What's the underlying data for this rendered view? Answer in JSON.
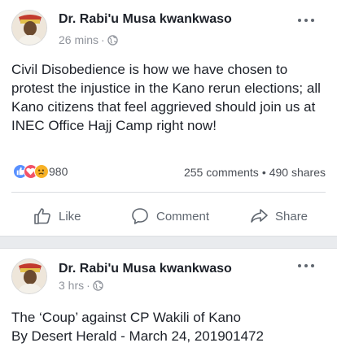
{
  "posts": [
    {
      "author": "Dr. Rabi'u Musa kwankwaso",
      "time": "26 mins",
      "text": "Civil Disobedience is how we have chosen to protest the injustice in the Kano rerun elections; all Kano citizens that feel aggrieved should join us at INEC Office Hajj Camp right now!",
      "reaction_count": "980",
      "comments": "255 comments",
      "shares": "490 shares",
      "actions": {
        "like": "Like",
        "comment": "Comment",
        "share": "Share"
      }
    },
    {
      "author": "Dr. Rabi'u Musa kwankwaso",
      "time": "3 hrs",
      "text_line1": "The ‘Coup’ against CP Wakili of Kano",
      "text_line2": "By Desert Herald - March 24, 201901472"
    }
  ],
  "meta_separator": "·",
  "stats_separator": "•",
  "colors": {
    "like_reaction": "#5890ff",
    "love_reaction": "#f25268",
    "sad_reaction": "#f7b125",
    "feed_background": "#e9ebee",
    "secondary_text": "#90949c"
  },
  "icons": {
    "privacy": "globe-icon",
    "menu": "more-options-icon",
    "like": "thumbs-up-icon",
    "comment": "speech-bubble-icon",
    "share": "share-arrow-icon"
  }
}
